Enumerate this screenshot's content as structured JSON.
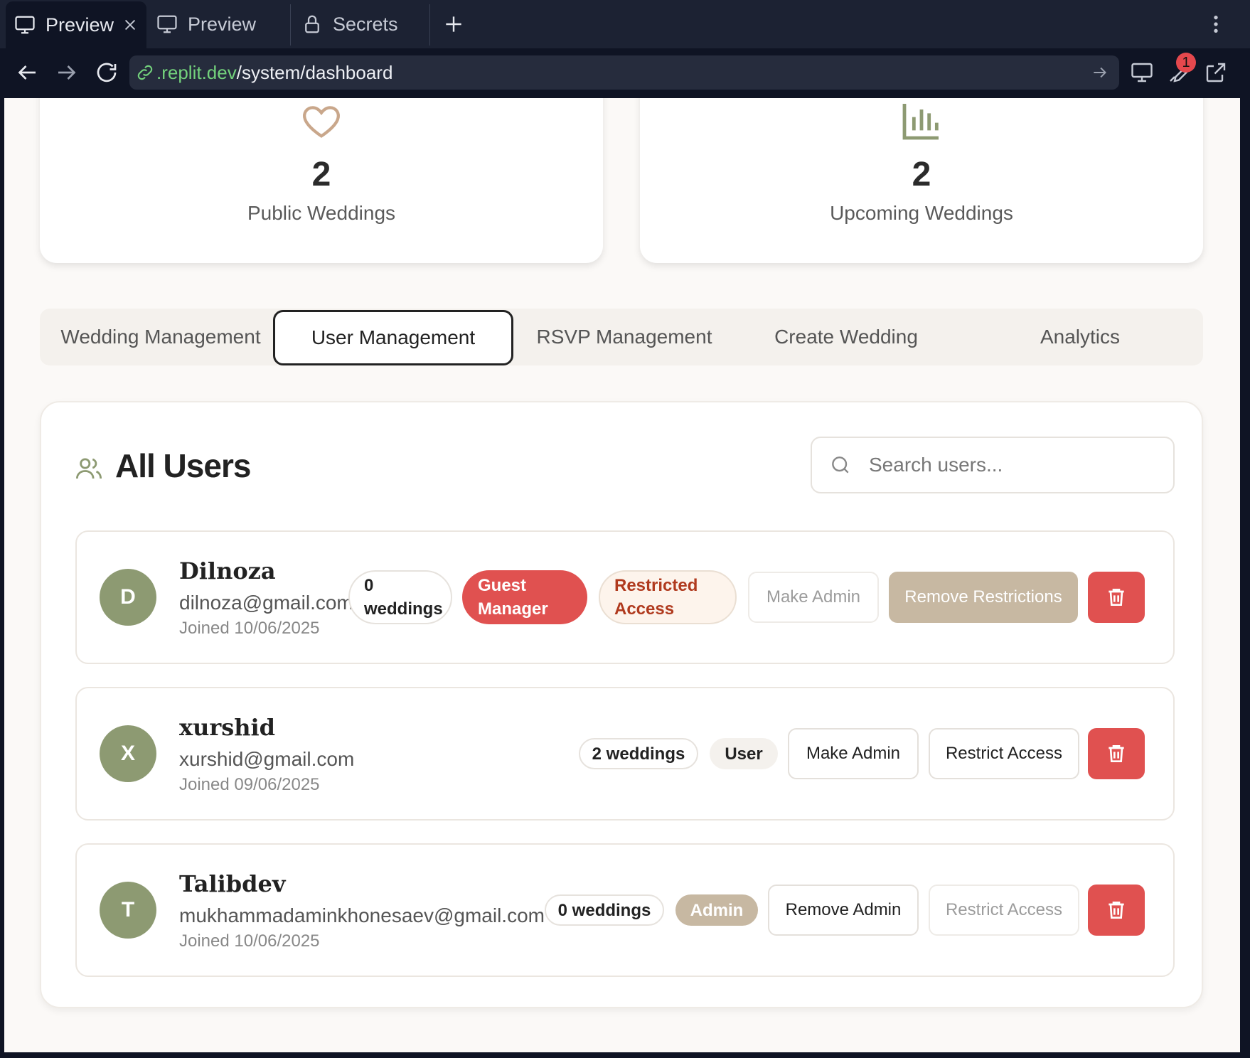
{
  "browser": {
    "tabs": [
      {
        "label": "Preview",
        "icon": "monitor-icon"
      },
      {
        "label": "Preview",
        "icon": "monitor-icon"
      },
      {
        "label": "Secrets",
        "icon": "lock-icon"
      }
    ],
    "url_host": ".replit.dev",
    "url_path": "/system/dashboard",
    "notification_count": "1"
  },
  "stats": [
    {
      "value": "2",
      "label": "Public Weddings",
      "icon": "heart-icon",
      "color": "#c9a78b"
    },
    {
      "value": "2",
      "label": "Upcoming Weddings",
      "icon": "bar-chart-icon",
      "color": "#8d9a72"
    }
  ],
  "tabs": [
    "Wedding Management",
    "User Management",
    "RSVP Management",
    "Create Wedding",
    "Analytics"
  ],
  "active_tab": "User Management",
  "users_panel": {
    "title": "All Users",
    "search_placeholder": "Search users..."
  },
  "users": [
    {
      "initial": "D",
      "name": "Dilnoza",
      "email": "dilnoza@gmail.com",
      "joined": "Joined 10/06/2025",
      "weddings_line1": "0",
      "weddings_line2": "weddings",
      "role_line1": "Guest",
      "role_line2": "Manager",
      "status_line1": "Restricted",
      "status_line2": "Access",
      "admin_button": "Make Admin",
      "access_button": "Remove Restrictions"
    },
    {
      "initial": "X",
      "name": "xurshid",
      "email": "xurshid@gmail.com",
      "joined": "Joined 09/06/2025",
      "weddings": "2 weddings",
      "role": "User",
      "admin_button": "Make Admin",
      "access_button": "Restrict Access"
    },
    {
      "initial": "T",
      "name": "Talibdev",
      "email": "mukhammadaminkhonesaev@gmail.com",
      "joined": "Joined 10/06/2025",
      "weddings": "0 weddings",
      "role": "Admin",
      "admin_button": "Remove Admin",
      "access_button": "Restrict Access"
    }
  ],
  "colors": {
    "avatar": "#8d9a72",
    "danger": "#e05150",
    "accent_tan": "#c7b8a2",
    "restricted_text": "#b03a1e"
  }
}
